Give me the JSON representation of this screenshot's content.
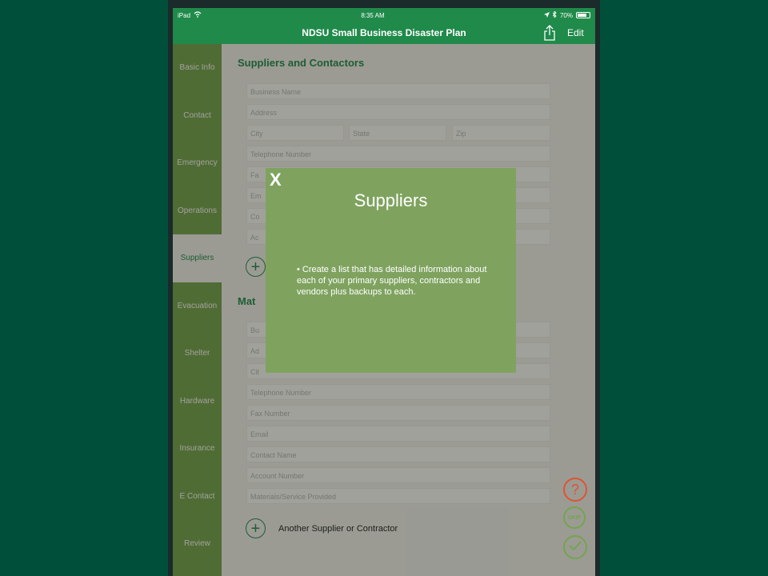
{
  "status": {
    "device": "iPad",
    "time": "8:35 AM",
    "battery": "70%"
  },
  "nav": {
    "title": "NDSU Small Business Disaster Plan",
    "edit": "Edit"
  },
  "sidebar": {
    "items": [
      {
        "label": "Basic Info"
      },
      {
        "label": "Contact"
      },
      {
        "label": "Emergency"
      },
      {
        "label": "Operations"
      },
      {
        "label": "Suppliers",
        "active": true
      },
      {
        "label": "Evacuation"
      },
      {
        "label": "Shelter"
      },
      {
        "label": "Hardware"
      },
      {
        "label": "Insurance"
      },
      {
        "label": "E Contact"
      },
      {
        "label": "Review"
      }
    ]
  },
  "content": {
    "section1_title": "Suppliers and Contactors",
    "section2_title": "Mat",
    "form1": {
      "business_name": "Business Name",
      "address": "Address",
      "city": "City",
      "state": "State",
      "zip": "Zip",
      "telephone": "Telephone Number",
      "fax": "Fa",
      "email": "Em",
      "contact": "Co",
      "account": "Ac"
    },
    "form2": {
      "business_name": "Bu",
      "address": "Ad",
      "city": "Cit",
      "telephone": "Telephone Number",
      "fax": "Fax Number",
      "email": "Email",
      "contact": "Contact Name",
      "account": "Account Number",
      "materials": "Materials/Service Provided"
    },
    "add_label": "Another Supplier or Contractor"
  },
  "fab": {
    "help": "?",
    "skip": "SKIP"
  },
  "modal": {
    "close": "X",
    "title": "Suppliers",
    "body": "• Create a list that has detailed information about each of your primary suppliers, contractors and vendors plus backups to each."
  },
  "colors": {
    "brand_green": "#1f8a4a",
    "sidebar_green": "#74a44f",
    "modal_green": "#7fa35f",
    "help_orange": "#e0532e"
  }
}
